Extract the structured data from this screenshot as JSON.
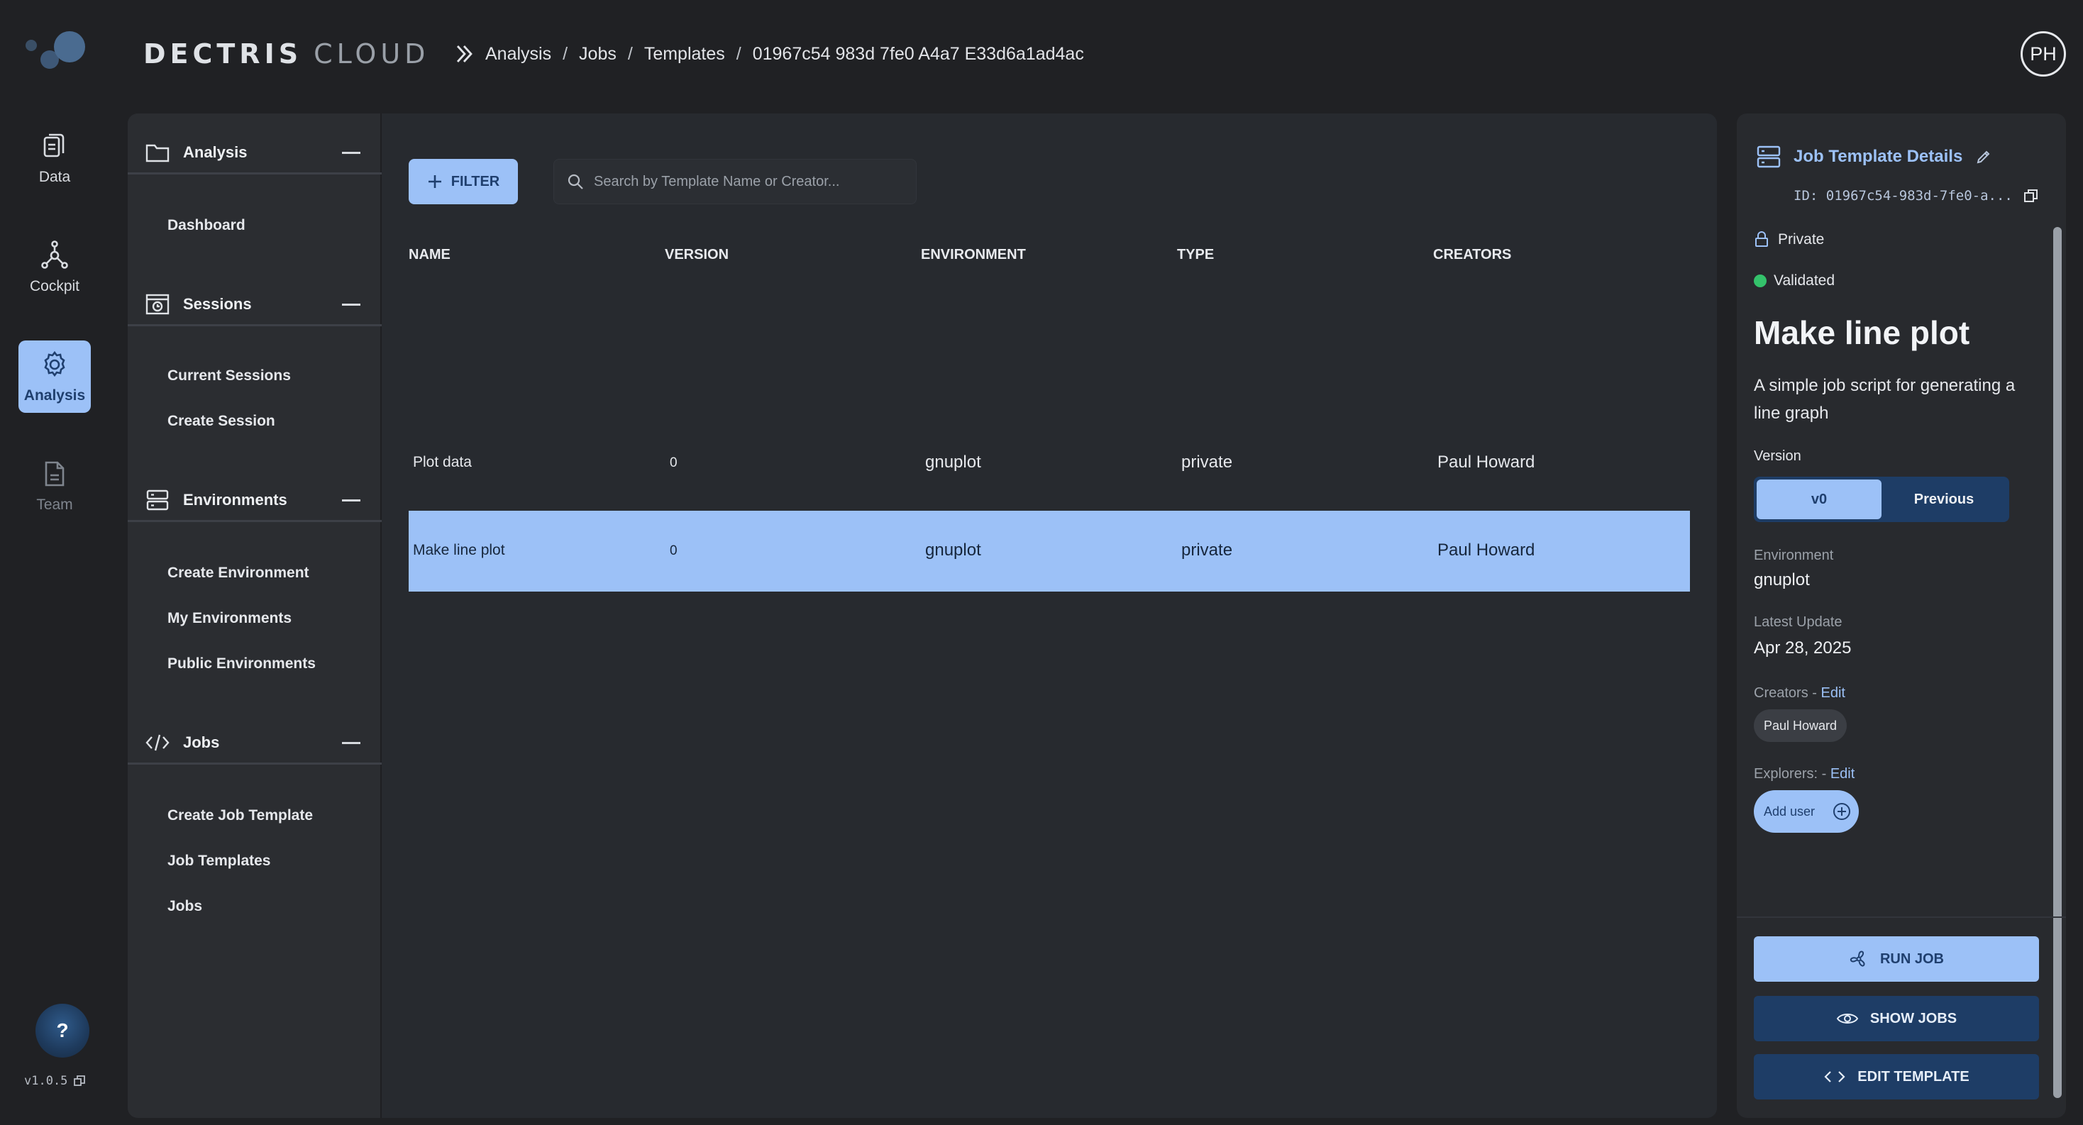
{
  "rail": {
    "items": [
      {
        "label": "Data",
        "icon": "data-icon"
      },
      {
        "label": "Cockpit",
        "icon": "cockpit-icon"
      },
      {
        "label": "Analysis",
        "icon": "gear-icon",
        "active": true
      },
      {
        "label": "Team",
        "icon": "document-icon",
        "disabled": true
      }
    ],
    "help_label": "?",
    "version": "v1.0.5"
  },
  "header": {
    "brand_primary": "DECTRIS",
    "brand_secondary": "CLOUD",
    "breadcrumbs": [
      "Analysis",
      "Jobs",
      "Templates",
      "01967c54 983d 7fe0 A4a7 E33d6a1ad4ac"
    ],
    "breadcrumb_separator": "/",
    "avatar_initials": "PH"
  },
  "subnav": {
    "sections": [
      {
        "title": "Analysis",
        "icon": "folder-icon",
        "links": [
          "Dashboard"
        ]
      },
      {
        "title": "Sessions",
        "icon": "session-icon",
        "links": [
          "Current Sessions",
          "Create Session"
        ]
      },
      {
        "title": "Environments",
        "icon": "server-icon",
        "links": [
          "Create Environment",
          "My Environments",
          "Public Environments"
        ]
      },
      {
        "title": "Jobs",
        "icon": "code-icon",
        "links": [
          "Create Job Template",
          "Job Templates",
          "Jobs"
        ]
      }
    ]
  },
  "toolbar": {
    "filter_label": "FILTER",
    "search_placeholder": "Search by Template Name or Creator..."
  },
  "table": {
    "columns": [
      "NAME",
      "VERSION",
      "ENVIRONMENT",
      "TYPE",
      "CREATORS"
    ],
    "rows": [
      {
        "name": "Plot data",
        "version": "0",
        "environment": "gnuplot",
        "type": "private",
        "creators": "Paul Howard",
        "selected": false
      },
      {
        "name": "Make line plot",
        "version": "0",
        "environment": "gnuplot",
        "type": "private",
        "creators": "Paul Howard",
        "selected": true
      }
    ]
  },
  "details": {
    "title": "Job Template Details",
    "id": "ID: 01967c54-983d-7fe0-a...",
    "visibility": "Private",
    "status": "Validated",
    "status_color": "#34c26b",
    "name": "Make line plot",
    "description": "A simple job script for generating a line graph",
    "version_label": "Version",
    "version_options": [
      "v0",
      "Previous"
    ],
    "environment_label": "Environment",
    "environment": "gnuplot",
    "latest_update_label": "Latest Update",
    "latest_update": "Apr 28, 2025",
    "creators_label": "Creators",
    "creators": [
      "Paul Howard"
    ],
    "explorers_label": "Explorers:",
    "edit_label": "Edit",
    "label_separator": " - ",
    "add_user_label": "Add user",
    "actions": {
      "run_job": "RUN JOB",
      "show_jobs": "SHOW JOBS",
      "edit_template": "EDIT TEMPLATE"
    }
  },
  "colors": {
    "accent": "#9cc1f7",
    "accent_dark": "#1e3d66",
    "background": "#202124",
    "panel": "#282a2e"
  }
}
